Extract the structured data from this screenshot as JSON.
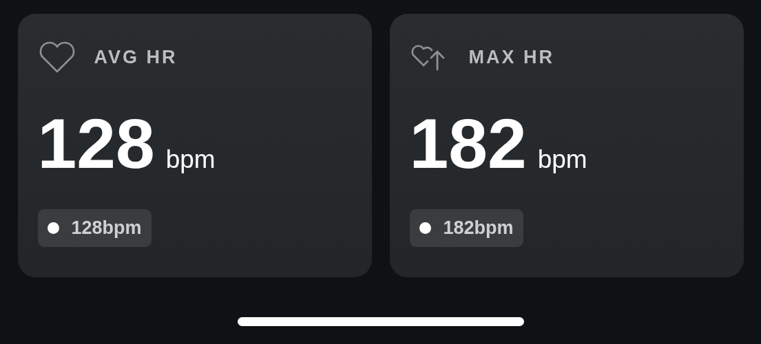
{
  "cards": [
    {
      "kind": "heart",
      "label": "AVG HR",
      "value": "128",
      "unit": "bpm",
      "chip": "128bpm"
    },
    {
      "kind": "heart-up",
      "label": "MAX HR",
      "value": "182",
      "unit": "bpm",
      "chip": "182bpm"
    }
  ]
}
